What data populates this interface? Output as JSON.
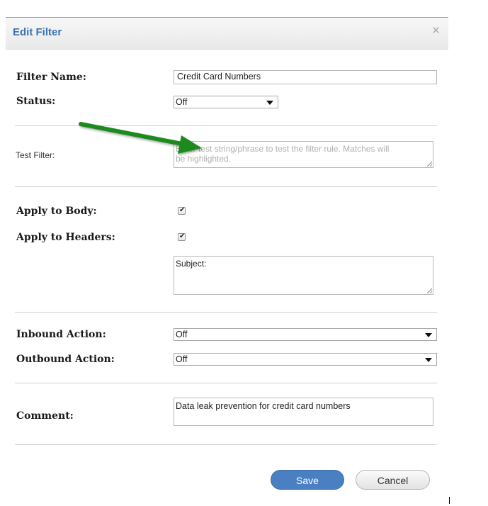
{
  "dialog": {
    "title": "Edit Filter",
    "close_icon": "×"
  },
  "form": {
    "filter_name_label": "Filter Name:",
    "filter_name_value": "Credit Card Numbers",
    "status_label": "Status:",
    "status_value": "Off",
    "test_filter_label": "Test Filter:",
    "test_filter_placeholder": "Enter test string/phrase to test the filter rule. Matches will be highlighted.",
    "test_filter_placeholder_line1": "Enter test string/phrase to test the filter rule. Matches will",
    "test_filter_placeholder_line2": "be highlighted.",
    "apply_body_label": "Apply to Body:",
    "apply_body_checked": true,
    "apply_headers_label": "Apply to Headers:",
    "apply_headers_checked": true,
    "headers_value": "Subject:",
    "inbound_label": "Inbound Action:",
    "inbound_value": "Off",
    "outbound_label": "Outbound Action:",
    "outbound_value": "Off",
    "comment_label": "Comment:",
    "comment_value": "Data leak prevention for credit card numbers"
  },
  "buttons": {
    "save_label": "Save",
    "cancel_label": "Cancel"
  },
  "annotation": {
    "arrow_color": "#1f8a1f",
    "arrow_icon": "annotation-arrow-icon"
  },
  "colors": {
    "title": "#3a73b5",
    "save_button": "#4a7fc1"
  }
}
